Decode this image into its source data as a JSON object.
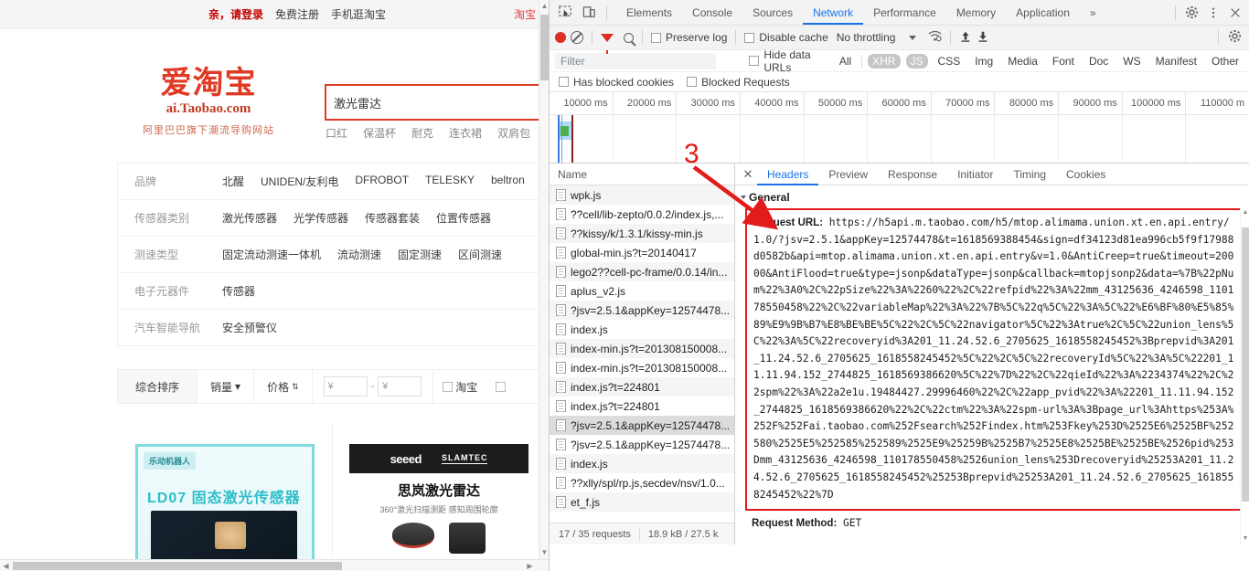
{
  "taobao": {
    "topbar": {
      "login": "亲，请登录",
      "register": "免费注册",
      "mobile": "手机逛淘宝",
      "right": "淘宝"
    },
    "logo": {
      "main": "爱淘宝",
      "sub": "ai.Taobao.com",
      "slogan": "阿里巴巴旗下潮流导购网站"
    },
    "search": {
      "value": "激光雷达",
      "placeholder": ""
    },
    "hotwords": [
      "口红",
      "保温杯",
      "耐克",
      "连衣裙",
      "双肩包"
    ],
    "filters": [
      {
        "label": "品牌",
        "values": [
          "北醒",
          "UNIDEN/友利电",
          "DFROBOT",
          "TELESKY",
          "beltron"
        ]
      },
      {
        "label": "传感器类别",
        "values": [
          "激光传感器",
          "光学传感器",
          "传感器套装",
          "位置传感器"
        ]
      },
      {
        "label": "测速类型",
        "values": [
          "固定流动测速一体机",
          "流动测速",
          "固定测速",
          "区间测速"
        ]
      },
      {
        "label": "电子元器件",
        "values": [
          "传感器"
        ]
      },
      {
        "label": "汽车智能导航",
        "values": [
          "安全预警仪"
        ]
      }
    ],
    "sortbar": {
      "comprehensive": "综合排序",
      "sales": "销量",
      "price": "价格",
      "currency_from": "¥",
      "currency_to": "¥",
      "dash": "-",
      "checkbox_taobao": "淘宝"
    },
    "results": [
      {
        "badge": "乐动机器人",
        "title": "LD07 固态激光传感器"
      },
      {
        "brand_left": "seeed",
        "brand_right": "SLAMTEC",
        "title": "思岚激光雷达",
        "subtitle": "360°激光扫描测距 感知周围轮廓"
      }
    ]
  },
  "devtools": {
    "tabs": [
      {
        "label": "Elements",
        "selected": false
      },
      {
        "label": "Console",
        "selected": false
      },
      {
        "label": "Sources",
        "selected": false
      },
      {
        "label": "Network",
        "selected": true
      },
      {
        "label": "Performance",
        "selected": false
      },
      {
        "label": "Memory",
        "selected": false
      },
      {
        "label": "Application",
        "selected": false
      }
    ],
    "tabs_overflow": "»",
    "toolbar": {
      "preserve_log": "Preserve log",
      "disable_cache": "Disable cache",
      "throttling": "No throttling"
    },
    "filterbar": {
      "filter_placeholder": "Filter",
      "hide_data_urls": "Hide data URLs",
      "types": [
        {
          "label": "All",
          "on": false
        },
        {
          "label": "XHR",
          "on": true
        },
        {
          "label": "JS",
          "on": true
        },
        {
          "label": "CSS",
          "on": false
        },
        {
          "label": "Img",
          "on": false
        },
        {
          "label": "Media",
          "on": false
        },
        {
          "label": "Font",
          "on": false
        },
        {
          "label": "Doc",
          "on": false
        },
        {
          "label": "WS",
          "on": false
        },
        {
          "label": "Manifest",
          "on": false
        },
        {
          "label": "Other",
          "on": false
        }
      ]
    },
    "cookiebar": {
      "has_blocked_cookies": "Has blocked cookies",
      "blocked_requests": "Blocked Requests"
    },
    "timeline": {
      "ticks": [
        "10000 ms",
        "20000 ms",
        "30000 ms",
        "40000 ms",
        "50000 ms",
        "60000 ms",
        "70000 ms",
        "80000 ms",
        "90000 ms",
        "100000 ms",
        "110000 m"
      ]
    },
    "requests": {
      "header": "Name",
      "rows": [
        {
          "name": "wpk.js",
          "selected": false
        },
        {
          "name": "??cell/lib-zepto/0.0.2/index.js,...",
          "selected": false
        },
        {
          "name": "??kissy/k/1.3.1/kissy-min.js",
          "selected": false
        },
        {
          "name": "global-min.js?t=20140417",
          "selected": false
        },
        {
          "name": "lego2??cell-pc-frame/0.0.14/in...",
          "selected": false
        },
        {
          "name": "aplus_v2.js",
          "selected": false
        },
        {
          "name": "?jsv=2.5.1&appKey=12574478...",
          "selected": false
        },
        {
          "name": "index.js",
          "selected": false
        },
        {
          "name": "index-min.js?t=201308150008...",
          "selected": false
        },
        {
          "name": "index-min.js?t=201308150008...",
          "selected": false
        },
        {
          "name": "index.js?t=224801",
          "selected": false
        },
        {
          "name": "index.js?t=224801",
          "selected": false
        },
        {
          "name": "?jsv=2.5.1&appKey=12574478...",
          "selected": true
        },
        {
          "name": "?jsv=2.5.1&appKey=12574478...",
          "selected": false
        },
        {
          "name": "index.js",
          "selected": false
        },
        {
          "name": "??xlly/spl/rp.js,secdev/nsv/1.0...",
          "selected": false
        },
        {
          "name": "et_f.js",
          "selected": false
        }
      ],
      "footer": {
        "requests": "17 / 35 requests",
        "transferred": "18.9 kB / 27.5 k"
      }
    },
    "detail_tabs": [
      {
        "label": "Headers",
        "selected": true
      },
      {
        "label": "Preview",
        "selected": false
      },
      {
        "label": "Response",
        "selected": false
      },
      {
        "label": "Initiator",
        "selected": false
      },
      {
        "label": "Timing",
        "selected": false
      },
      {
        "label": "Cookies",
        "selected": false
      }
    ],
    "general": {
      "section_title": "General",
      "request_url_label": "Request URL:",
      "request_url_value": "https://h5api.m.taobao.com/h5/mtop.alimama.union.xt.en.api.entry/1.0/?jsv=2.5.1&appKey=12574478&t=1618569388454&sign=df34123d81ea996cb5f9f17988d0582b&api=mtop.alimama.union.xt.en.api.entry&v=1.0&AntiCreep=true&timeout=20000&AntiFlood=true&type=jsonp&dataType=jsonp&callback=mtopjsonp2&data=%7B%22pNum%22%3A0%2C%22pSize%22%3A%2260%22%2C%22refpid%22%3A%22mm_43125636_4246598_110178550458%22%2C%22variableMap%22%3A%22%7B%5C%22q%5C%22%3A%5C%22%E6%BF%80%E5%85%89%E9%9B%B7%E8%BE%BE%5C%22%2C%5C%22navigator%5C%22%3Atrue%2C%5C%22union_lens%5C%22%3A%5C%22recoveryid%3A201_11.24.52.6_2705625_1618558245452%3Bprepvid%3A201_11.24.52.6_2705625_1618558245452%5C%22%2C%5C%22recoveryId%5C%22%3A%5C%22201_11.11.94.152_2744825_1618569386620%5C%22%7D%22%2C%22qieId%22%3A%2234374%22%2C%22spm%22%3A%22a2e1u.19484427.29996460%22%2C%22app_pvid%22%3A%22201_11.11.94.152_2744825_1618569386620%22%2C%22ctm%22%3A%22spm-url%3A%3Bpage_url%3Ahttps%253A%252F%252Fai.taobao.com%252Fsearch%252Findex.htm%253Fkey%253D%2525E6%2525BF%252580%2525E5%252585%252589%2525E9%25259B%2525B7%2525E8%2525BE%2525BE%2526pid%253Dmm_43125636_4246598_110178550458%2526union_lens%253Drecoveryid%25253A201_11.24.52.6_2705625_1618558245452%25253Bprepvid%25253A201_11.24.52.6_2705625_1618558245452%22%7D",
      "request_method_label": "Request Method:",
      "request_method_value": "GET"
    }
  },
  "annotation": {
    "number": "3",
    "color": "#e21b1b"
  }
}
